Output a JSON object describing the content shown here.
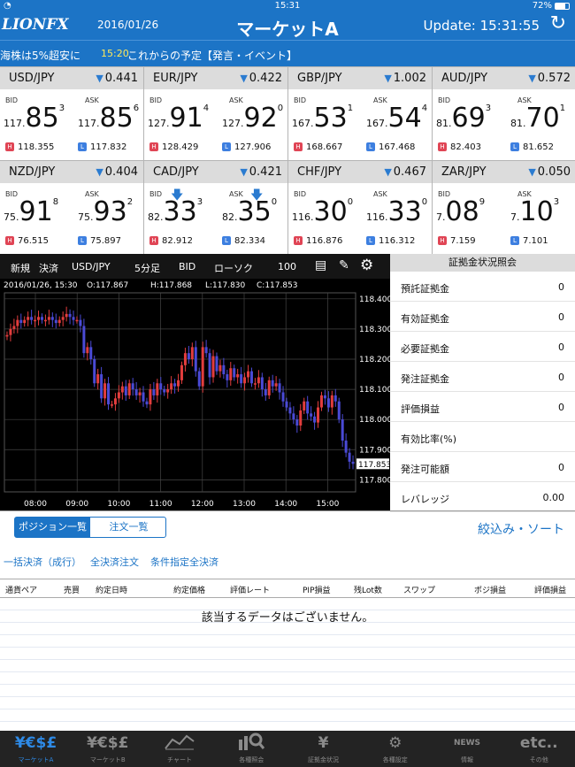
{
  "status_bar": {
    "time": "15:31",
    "battery": "72%"
  },
  "header": {
    "logo": "LIONFX",
    "date": "2016/01/26",
    "title": "マーケットA",
    "update_label": "Update: 15:31:55"
  },
  "ticker": {
    "headline": "海株は5%超安に",
    "time": "15:20",
    "text": "これからの予定【発言・イベント】"
  },
  "tiles": [
    {
      "pair": "USD/JPY",
      "change": "0.441",
      "bid_label": "BID",
      "ask_label": "ASK",
      "bid_prefix": "117.",
      "bid_big": "85",
      "bid_sup": "3",
      "ask_prefix": "117.",
      "ask_big": "85",
      "ask_sup": "6",
      "high": "118.355",
      "low": "117.832",
      "high_badge": "H",
      "low_badge": "L"
    },
    {
      "pair": "EUR/JPY",
      "change": "0.422",
      "bid_label": "BID",
      "ask_label": "ASK",
      "bid_prefix": "127.",
      "bid_big": "91",
      "bid_sup": "4",
      "ask_prefix": "127.",
      "ask_big": "92",
      "ask_sup": "0",
      "high": "128.429",
      "low": "127.906",
      "high_badge": "H",
      "low_badge": "L"
    },
    {
      "pair": "GBP/JPY",
      "change": "1.002",
      "bid_label": "BID",
      "ask_label": "ASK",
      "bid_prefix": "167.",
      "bid_big": "53",
      "bid_sup": "1",
      "ask_prefix": "167.",
      "ask_big": "54",
      "ask_sup": "4",
      "high": "168.667",
      "low": "167.468",
      "high_badge": "H",
      "low_badge": "L"
    },
    {
      "pair": "AUD/JPY",
      "change": "0.572",
      "bid_label": "BID",
      "ask_label": "ASK",
      "bid_prefix": "81.",
      "bid_big": "69",
      "bid_sup": "3",
      "ask_prefix": "81.",
      "ask_big": "70",
      "ask_sup": "1",
      "high": "82.403",
      "low": "81.652",
      "high_badge": "H",
      "low_badge": "L"
    },
    {
      "pair": "NZD/JPY",
      "change": "0.404",
      "bid_label": "BID",
      "ask_label": "ASK",
      "bid_prefix": "75.",
      "bid_big": "91",
      "bid_sup": "8",
      "ask_prefix": "75.",
      "ask_big": "93",
      "ask_sup": "2",
      "high": "76.515",
      "low": "75.897",
      "high_badge": "H",
      "low_badge": "L"
    },
    {
      "pair": "CAD/JPY",
      "change": "0.421",
      "bid_label": "BID",
      "ask_label": "ASK",
      "bid_prefix": "82.",
      "bid_big": "33",
      "bid_sup": "3",
      "ask_prefix": "82.",
      "ask_big": "35",
      "ask_sup": "0",
      "high": "82.912",
      "low": "82.334",
      "high_badge": "H",
      "low_badge": "L",
      "down_arrows": true
    },
    {
      "pair": "CHF/JPY",
      "change": "0.467",
      "bid_label": "BID",
      "ask_label": "ASK",
      "bid_prefix": "116.",
      "bid_big": "30",
      "bid_sup": "0",
      "ask_prefix": "116.",
      "ask_big": "33",
      "ask_sup": "0",
      "high": "116.876",
      "low": "116.312",
      "high_badge": "H",
      "low_badge": "L"
    },
    {
      "pair": "ZAR/JPY",
      "change": "0.050",
      "bid_label": "BID",
      "ask_label": "ASK",
      "bid_prefix": "7.",
      "bid_big": "08",
      "bid_sup": "9",
      "ask_prefix": "7.",
      "ask_big": "10",
      "ask_sup": "3",
      "high": "7.159",
      "low": "7.101",
      "high_badge": "H",
      "low_badge": "L"
    }
  ],
  "chart_toolbar": {
    "new_order": "新規",
    "settle": "決済",
    "pair": "USD/JPY",
    "period": "5分足",
    "side": "BID",
    "candle_type": "ローソク",
    "count": "100"
  },
  "chart_info": {
    "datetime": "2016/01/26, 15:30",
    "open": "O:117.867",
    "high": "H:117.868",
    "low": "L:117.830",
    "close": "C:117.853"
  },
  "chart_data": {
    "type": "candlestick",
    "y_ticks": [
      "118.400",
      "118.300",
      "118.200",
      "118.100",
      "118.000",
      "117.900",
      "117.800"
    ],
    "x_ticks": [
      "08:00",
      "09:00",
      "10:00",
      "11:00",
      "12:00",
      "13:00",
      "14:00",
      "15:00"
    ],
    "ylim": [
      117.76,
      118.42
    ],
    "current_price": "117.853",
    "up_color": "#e23d3d",
    "down_color": "#4a4ad6",
    "closes": [
      118.28,
      118.3,
      118.31,
      118.33,
      118.32,
      118.33,
      118.34,
      118.33,
      118.33,
      118.34,
      118.33,
      118.33,
      118.34,
      118.33,
      118.32,
      118.33,
      118.34,
      118.35,
      118.34,
      118.33,
      118.33,
      118.31,
      118.22,
      118.24,
      118.2,
      118.12,
      118.15,
      118.07,
      118.12,
      118.05,
      118.05,
      118.07,
      118.09,
      118.11,
      118.08,
      118.12,
      118.1,
      118.08,
      118.09,
      118.06,
      118.05,
      118.1,
      118.08,
      118.12,
      118.1,
      118.09,
      118.1,
      118.12,
      118.11,
      118.13,
      118.18,
      118.22,
      118.2,
      118.24,
      118.16,
      118.11,
      118.24,
      118.22,
      118.14,
      118.21,
      118.16,
      118.18,
      118.15,
      118.13,
      118.17,
      118.14,
      118.15,
      118.12,
      118.14,
      118.16,
      118.12,
      118.12,
      118.14,
      118.1,
      118.08,
      118.13,
      118.11,
      118.12,
      118.09,
      118.06,
      118.04,
      118.02,
      118.0,
      117.98,
      118.03,
      118.06,
      118.02,
      118.01,
      117.99,
      118.04,
      118.08,
      118.07,
      118.04,
      118.08,
      118.06,
      118.0,
      117.93,
      117.89,
      117.86,
      117.853
    ]
  },
  "margin_panel": {
    "title": "証拠金状況照会",
    "rows": [
      {
        "k": "預託証拠金",
        "v": "0"
      },
      {
        "k": "有効証拠金",
        "v": "0"
      },
      {
        "k": "必要証拠金",
        "v": "0"
      },
      {
        "k": "発注証拠金",
        "v": "0"
      },
      {
        "k": "評価損益",
        "v": "0"
      },
      {
        "k": "有効比率(%)",
        "v": ""
      },
      {
        "k": "発注可能額",
        "v": "0"
      },
      {
        "k": "レバレッジ",
        "v": "0.00"
      }
    ]
  },
  "segmented": {
    "positions": "ポジション一覧",
    "orders": "注文一覧"
  },
  "sort_link": "絞込み・ソート",
  "actions": {
    "bulk": "一括決済（成行）",
    "all": "全決済注文",
    "cond": "条件指定全決済"
  },
  "table_headers": [
    "通貨ペア",
    "売買",
    "約定日時",
    "約定価格",
    "評価レート",
    "PIP損益",
    "残Lot数",
    "スワップ",
    "ポジ損益",
    "評価損益"
  ],
  "empty_message": "該当するデータはございません。",
  "tabs": [
    {
      "glyph": "¥€$£",
      "label": "マーケットA",
      "icon": "currency-icon",
      "active": true
    },
    {
      "glyph": "¥€$£",
      "label": "マーケットB",
      "icon": "currency-icon",
      "active": false
    },
    {
      "glyph": "",
      "label": "チャート",
      "icon": "chart-icon",
      "active": false
    },
    {
      "glyph": "",
      "label": "各種照会",
      "icon": "search-icon",
      "active": false
    },
    {
      "glyph": "¥",
      "label": "証拠金状況",
      "icon": "yen-bars-icon",
      "active": false
    },
    {
      "glyph": "⚙",
      "label": "各種設定",
      "icon": "gear-wrench-icon",
      "active": false
    },
    {
      "glyph": "NEWS",
      "label": "情報",
      "icon": "news-icon",
      "active": false
    },
    {
      "glyph": "etc..",
      "label": "その他",
      "icon": "etc-icon",
      "active": false
    }
  ]
}
